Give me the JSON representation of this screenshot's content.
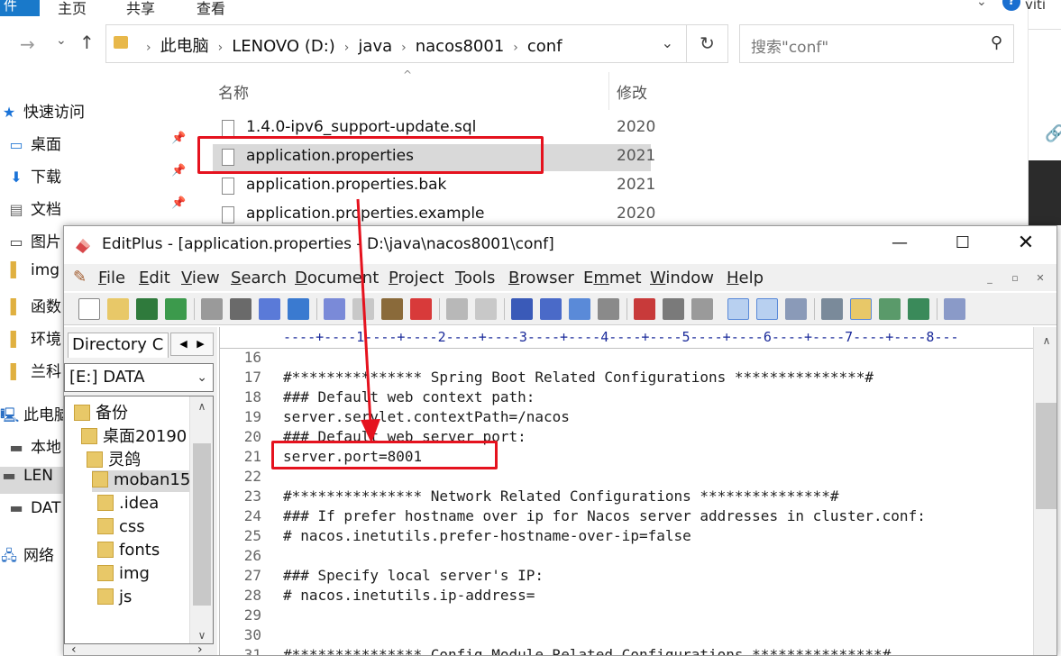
{
  "explorer": {
    "ribbon_tabs": [
      "件",
      "主页",
      "共享",
      "查看"
    ],
    "right_strip_text": "viti",
    "address": {
      "crumbs": [
        "此电脑",
        "LENOVO (D:)",
        "java",
        "nacos8001",
        "conf"
      ]
    },
    "search_placeholder": "搜索\"conf\"",
    "column_name": "名称",
    "column_modified": "修改",
    "nav_items": [
      {
        "label": "快速访问",
        "icon": "star-icon"
      },
      {
        "label": "桌面",
        "icon": "desktop-icon",
        "pinned": true
      },
      {
        "label": "下载",
        "icon": "download-icon",
        "pinned": true
      },
      {
        "label": "文档",
        "icon": "document-icon",
        "pinned": true
      },
      {
        "label": "图片",
        "icon": "picture-icon"
      },
      {
        "label": "img",
        "icon": "folder-icon"
      },
      {
        "label": "函数",
        "icon": "folder-icon"
      },
      {
        "label": "环境",
        "icon": "folder-icon"
      },
      {
        "label": "兰科",
        "icon": "folder-icon"
      },
      {
        "label": "此电脑",
        "icon": "computer-icon"
      },
      {
        "label": "本地",
        "icon": "drive-icon"
      },
      {
        "label": "LEN",
        "icon": "drive-icon"
      },
      {
        "label": "DAT",
        "icon": "drive-icon"
      },
      {
        "label": "网络",
        "icon": "network-icon"
      }
    ],
    "files": [
      {
        "name": "1.4.0-ipv6_support-update.sql",
        "date": "2020"
      },
      {
        "name": "application.properties",
        "date": "2021",
        "selected": true
      },
      {
        "name": "application.properties.bak",
        "date": "2021"
      },
      {
        "name": "application.properties.example",
        "date": "2020"
      }
    ]
  },
  "editplus": {
    "title": "EditPlus - [application.properties - D:\\java\\nacos8001\\conf]",
    "menu": [
      {
        "key": "F",
        "rest": "ile"
      },
      {
        "key": "E",
        "rest": "dit"
      },
      {
        "key": "V",
        "rest": "iew"
      },
      {
        "key": "S",
        "rest": "earch"
      },
      {
        "key": "D",
        "rest": "ocument"
      },
      {
        "key": "P",
        "rest": "roject"
      },
      {
        "key": "T",
        "rest": "ools"
      },
      {
        "key": "B",
        "rest": "rowser"
      },
      {
        "key": "m",
        "rest": "met",
        "prefix": "E"
      },
      {
        "key": "W",
        "rest": "indow"
      },
      {
        "key": "H",
        "rest": "elp"
      }
    ],
    "dir_tab": "Directory",
    "dir_tab2": "C",
    "drive": "[E:] DATA",
    "tree": [
      "备份",
      "桌面20190",
      "灵鸽",
      "moban15",
      ".idea",
      "css",
      "fonts",
      "img",
      "js"
    ],
    "ruler": "----+----1----+----2----+----3----+----4----+----5----+----6----+----7----+----8---",
    "code": [
      {
        "n": "16",
        "t": ""
      },
      {
        "n": "17",
        "t": "#*************** Spring Boot Related Configurations ***************#"
      },
      {
        "n": "18",
        "t": "### Default web context path:"
      },
      {
        "n": "19",
        "t": "server.servlet.contextPath=/nacos"
      },
      {
        "n": "20",
        "t": "### Default web server port:"
      },
      {
        "n": "21",
        "t": "server.port=8001"
      },
      {
        "n": "22",
        "t": ""
      },
      {
        "n": "23",
        "t": "#*************** Network Related Configurations ***************#"
      },
      {
        "n": "24",
        "t": "### If prefer hostname over ip for Nacos server addresses in cluster.conf:"
      },
      {
        "n": "25",
        "t": "# nacos.inetutils.prefer-hostname-over-ip=false"
      },
      {
        "n": "26",
        "t": ""
      },
      {
        "n": "27",
        "t": "### Specify local server's IP:"
      },
      {
        "n": "28",
        "t": "# nacos.inetutils.ip-address="
      },
      {
        "n": "29",
        "t": ""
      },
      {
        "n": "30",
        "t": ""
      },
      {
        "n": "31",
        "t": "#*************** Config Module Related Configurations ***************#"
      }
    ]
  },
  "colors": {
    "annotation": "#e5121e",
    "selection": "#d9d9d9",
    "ruler": "#1a2a9a"
  }
}
